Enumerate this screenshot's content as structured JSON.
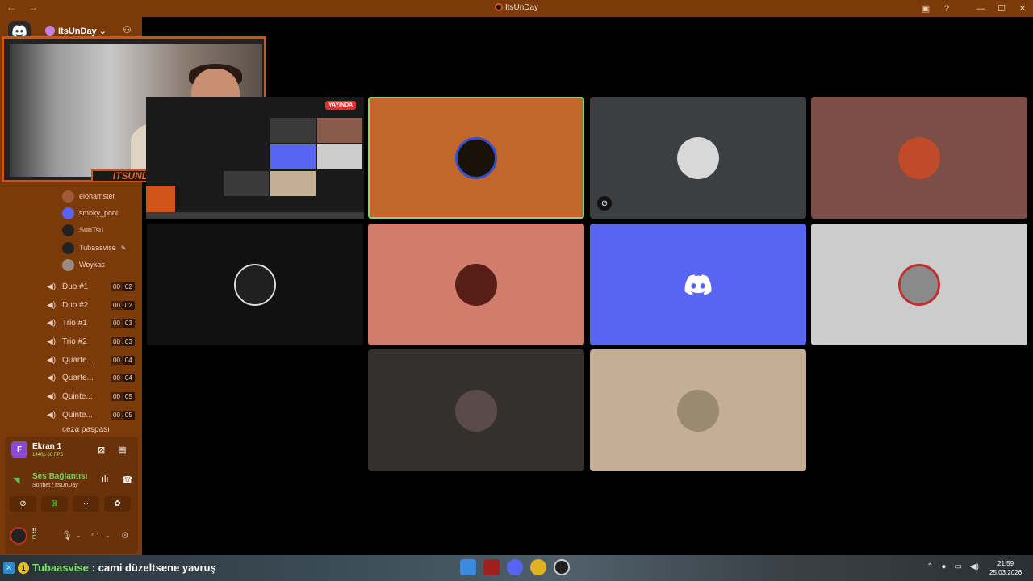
{
  "window": {
    "title": "ItsUnDay",
    "nav": "← →"
  },
  "server": {
    "name": "ItsUnDay ⌄"
  },
  "members": [
    {
      "name": "elohamster"
    },
    {
      "name": "smoky_pool"
    },
    {
      "name": "SunTsu"
    },
    {
      "name": "Tubaasvise"
    },
    {
      "name": "Woykas"
    }
  ],
  "channels": [
    {
      "name": "Duo #1",
      "a": "00",
      "b": "02"
    },
    {
      "name": "Duo #2",
      "a": "00",
      "b": "02"
    },
    {
      "name": "Trio #1",
      "a": "00",
      "b": "03"
    },
    {
      "name": "Trio #2",
      "a": "00",
      "b": "03"
    },
    {
      "name": "Quarte...",
      "a": "00",
      "b": "04"
    },
    {
      "name": "Quarte...",
      "a": "00",
      "b": "04"
    },
    {
      "name": "Quinte...",
      "a": "00",
      "b": "05"
    },
    {
      "name": "Quinte...",
      "a": "00",
      "b": "05"
    },
    {
      "name": "ceza paspası",
      "a": "",
      "b": ""
    }
  ],
  "screen_share": {
    "label": "Ekran 1",
    "quality": "1440p 60 FPS",
    "initial": "F"
  },
  "voice": {
    "status": "Ses Bağlantısı K",
    "location": "Sohbet / ItsUnDay"
  },
  "user": {
    "name": "!!",
    "status": "E"
  },
  "webcam": {
    "overlay_text": "ITSUNDAY"
  },
  "stream": {
    "live_label": "YAYINDA"
  },
  "tiles": [
    {
      "color": "#c2662c",
      "avatar_color": "#1a1208",
      "speaking": true
    },
    {
      "color": "#3c3e40",
      "avatar_color": "#d8d8d8",
      "muted": true
    },
    {
      "color": "#7d4e48",
      "avatar_color": "#c04a2a"
    },
    {
      "color": "#111111",
      "avatar_color": "#202020"
    },
    {
      "color": "#d27c6c",
      "avatar_color": "#5a1e18"
    },
    {
      "color": "#5865f2",
      "avatar_color": "#5865f2"
    },
    {
      "color": "#cccccc",
      "avatar_color": "#8a8a8a"
    },
    {
      "color": "#33302e",
      "avatar_color": "#5a4a4a"
    },
    {
      "color": "#c4ae94",
      "avatar_color": "#9a8a70"
    }
  ],
  "chat_overlay": {
    "username": "Tubaasvise",
    "message": ": cami düzeltsene yavruş"
  },
  "clock": {
    "time": "21:59",
    "date": "25.03.2026"
  }
}
